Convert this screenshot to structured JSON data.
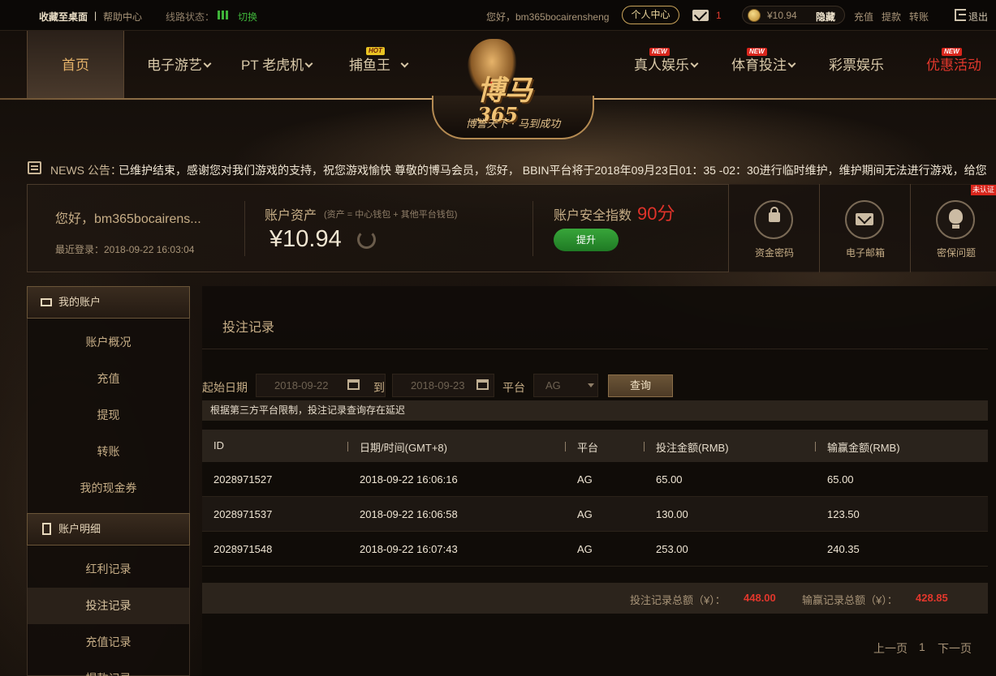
{
  "topbar": {
    "favorite": "收藏至桌面",
    "separator": "|",
    "help": "帮助中心",
    "line_status_label": "线路状态：",
    "switch": "切换",
    "greeting": "您好，bm365bocairensheng",
    "personal_center": "个人中心",
    "mail_count": "1",
    "balance": "¥10.94",
    "hide": "隐藏",
    "deposit": "充值",
    "withdraw": "提款",
    "transfer": "转账",
    "logout": "退出",
    "colors": {
      "online": "#3fb43a",
      "alert": "#e03b2e"
    }
  },
  "nav": {
    "items": [
      {
        "label": "首页"
      },
      {
        "label": "电子游艺"
      },
      {
        "label": "PT 老虎机"
      },
      {
        "label": "捕鱼王",
        "badge": "HOT"
      },
      {
        "label": "真人娱乐",
        "badge": "NEW"
      },
      {
        "label": "体育投注",
        "badge": "NEW"
      },
      {
        "label": "彩票娱乐"
      },
      {
        "label": "优惠活动",
        "badge": "NEW"
      }
    ],
    "logo": {
      "name": "博马",
      "number": "365",
      "slogan": "博誉天下 · 马到成功"
    }
  },
  "news": {
    "label": "NEWS 公告：",
    "text": "已维护结束，感谢您对我们游戏的支持，祝您游戏愉快      尊敬的博马会员，您好， BBIN平台将于2018年09月23日01：35 -02：30进行临时维护，维护期间无法进行游戏，给您"
  },
  "account": {
    "greeting": "您好，bm365bocairens...",
    "last_login": "最近登录：2018-09-22 16:03:04",
    "assets_label": "账户资产",
    "assets_sub": "(资产 = 中心钱包 + 其他平台钱包)",
    "assets_value": "¥10.94",
    "security_label": "账户安全指数",
    "security_score": "90分",
    "upgrade": "提升",
    "tiles": [
      {
        "label": "资金密码",
        "icon": "lock-icon"
      },
      {
        "label": "电子邮箱",
        "icon": "envelope-icon"
      },
      {
        "label": "密保问题",
        "icon": "lightbulb-icon"
      }
    ],
    "unverified": "未认证"
  },
  "sidebar": {
    "section1": "我的账户",
    "items1": [
      "账户概况",
      "充值",
      "提现",
      "转账",
      "我的现金券"
    ],
    "section2": "账户明细",
    "items2": [
      "红利记录",
      "投注记录",
      "充值记录",
      "提款记录"
    ]
  },
  "main": {
    "title": "投注记录",
    "filter": {
      "start_label": "起始日期",
      "start_date": "2018-09-22",
      "to_label": "到",
      "end_date": "2018-09-23",
      "platform_label": "平台",
      "platform": "AG",
      "query": "查询"
    },
    "notice": "根据第三方平台限制，投注记录查询存在延迟",
    "table": {
      "columns": [
        "ID",
        "日期/时间(GMT+8)",
        "平台",
        "投注金额(RMB)",
        "输赢金额(RMB)"
      ],
      "rows": [
        [
          "2028971527",
          "2018-09-22 16:06:16",
          "AG",
          "65.00",
          "65.00"
        ],
        [
          "2028971537",
          "2018-09-22 16:06:58",
          "AG",
          "130.00",
          "123.50"
        ],
        [
          "2028971548",
          "2018-09-22 16:07:43",
          "AG",
          "253.00",
          "240.35"
        ]
      ]
    },
    "summary": {
      "bet_label": "投注记录总额（¥）：",
      "bet_total": "448.00",
      "win_label": "输赢记录总额（¥）：",
      "win_total": "428.85"
    },
    "pager": {
      "prev": "上一页",
      "page": "1",
      "next": "下一页"
    }
  }
}
